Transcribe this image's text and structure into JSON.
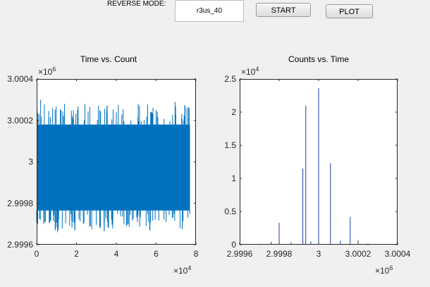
{
  "controls": {
    "mode_label": "REVERSE MODE:",
    "mode_value": "r3us_40",
    "start_label": "START",
    "plot_label": "PLOT"
  },
  "colors": {
    "series": "#0072bd",
    "series_thin": "#1f3fa8",
    "axes": "#262626",
    "background": "#f0f0f0",
    "plot_bg": "#ffffff"
  },
  "chart_data": [
    {
      "type": "line",
      "title": "Time vs. Count",
      "x_multiplier": "×10^4",
      "y_multiplier": "×10^6",
      "xlim": [
        0,
        80000
      ],
      "ylim": [
        2999600,
        3000400
      ],
      "x_ticks": [
        0,
        20000,
        40000,
        60000,
        80000
      ],
      "x_tick_labels": [
        "0",
        "2",
        "4",
        "6",
        "8"
      ],
      "y_ticks": [
        2999600,
        2999800,
        3000000,
        3000200,
        3000400
      ],
      "y_tick_labels": [
        "2.9996",
        "2.9998",
        "3",
        "3.0002",
        "3.0004"
      ],
      "series": [
        {
          "x_range": [
            0,
            77000
          ],
          "dense_band": [
            2999765,
            3000180
          ],
          "spikes": [
            {
              "x": 2000,
              "y": 3000300
            },
            {
              "x": 3500,
              "y": 2999700
            },
            {
              "x": 8000,
              "y": 3000260
            },
            {
              "x": 10500,
              "y": 2999660
            },
            {
              "x": 14000,
              "y": 3000280
            },
            {
              "x": 18000,
              "y": 2999710
            },
            {
              "x": 20500,
              "y": 3000250
            },
            {
              "x": 27000,
              "y": 2999690
            },
            {
              "x": 31000,
              "y": 3000270
            },
            {
              "x": 35500,
              "y": 2999720
            },
            {
              "x": 40000,
              "y": 3000240
            },
            {
              "x": 46000,
              "y": 2999700
            },
            {
              "x": 51000,
              "y": 3000280
            },
            {
              "x": 55000,
              "y": 2999690
            },
            {
              "x": 60000,
              "y": 3000250
            },
            {
              "x": 65000,
              "y": 2999710
            },
            {
              "x": 69500,
              "y": 3000290
            },
            {
              "x": 72000,
              "y": 2999680
            },
            {
              "x": 75500,
              "y": 3000260
            }
          ]
        }
      ]
    },
    {
      "type": "bar",
      "title": "Counts vs. Time",
      "x_multiplier": "×10^6",
      "y_multiplier": "×10^4",
      "xlim": [
        2999600,
        3000400
      ],
      "ylim": [
        0,
        25000
      ],
      "x_ticks": [
        2999600,
        2999800,
        3000000,
        3000200,
        3000400
      ],
      "x_tick_labels": [
        "2.9996",
        "2.9998",
        "3",
        "3.0002",
        "3.0004"
      ],
      "y_ticks": [
        0,
        5000,
        10000,
        15000,
        20000,
        25000
      ],
      "y_tick_labels": [
        "0",
        "0.5",
        "1",
        "1.5",
        "2",
        "2.5"
      ],
      "x": [
        2999700,
        2999760,
        2999800,
        2999860,
        2999920,
        2999935,
        2999960,
        3000000,
        3000060,
        3000110,
        3000160,
        3000200,
        3000250
      ],
      "values": [
        150,
        450,
        3300,
        400,
        11500,
        21000,
        500,
        23600,
        12300,
        600,
        4200,
        700,
        200
      ]
    }
  ]
}
